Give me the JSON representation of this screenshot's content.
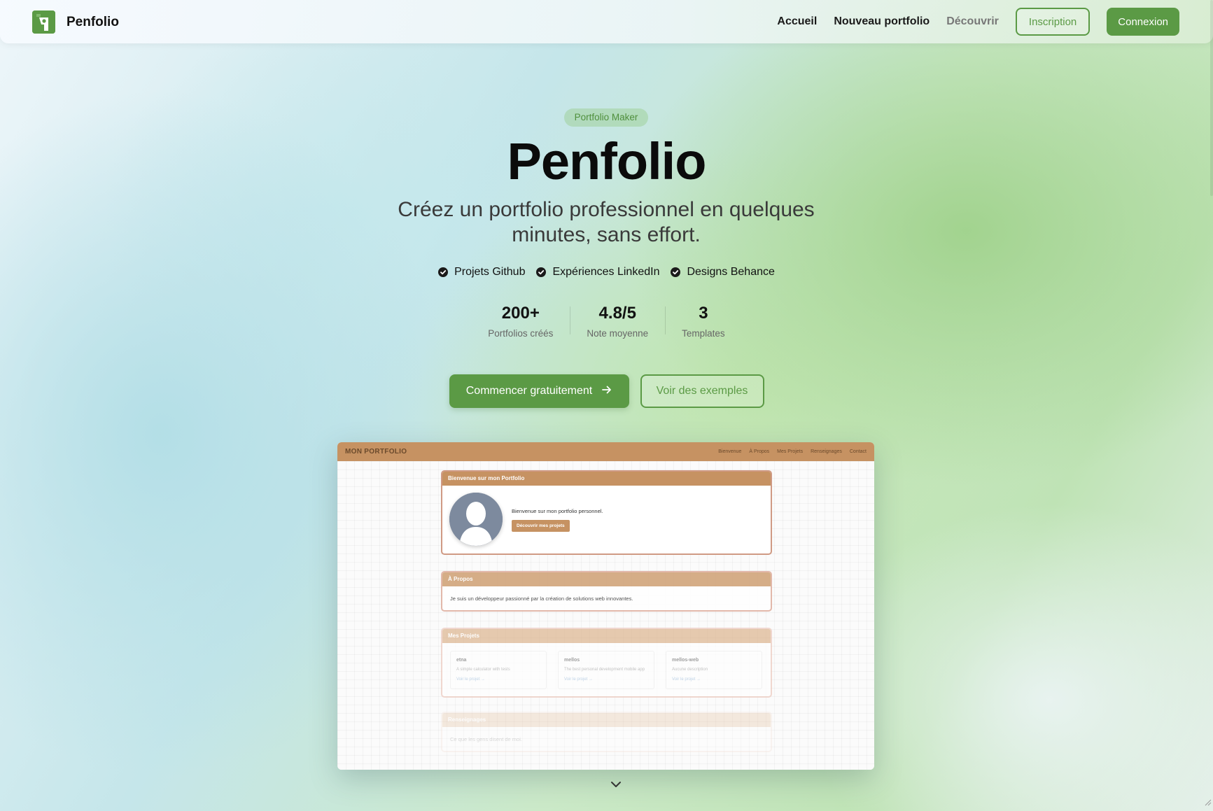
{
  "header": {
    "brand": "Penfolio",
    "nav": {
      "accueil": "Accueil",
      "nouveau": "Nouveau portfolio",
      "decouvrir": "Découvrir",
      "inscription": "Inscription",
      "connexion": "Connexion"
    }
  },
  "hero": {
    "tag": "Portfolio Maker",
    "title": "Penfolio",
    "subtitle": "Créez un portfolio professionnel en quelques minutes, sans effort.",
    "features": [
      "Projets Github",
      "Expériences LinkedIn",
      "Designs Behance"
    ],
    "stats": [
      {
        "value": "200+",
        "label": "Portfolios créés"
      },
      {
        "value": "4.8/5",
        "label": "Note moyenne"
      },
      {
        "value": "3",
        "label": "Templates"
      }
    ],
    "cta_primary": "Commencer gratuitement",
    "cta_secondary": "Voir des exemples"
  },
  "preview": {
    "brand": "MON PORTFOLIO",
    "nav": [
      "Bienvenue",
      "À Propos",
      "Mes Projets",
      "Renseignages",
      "Contact"
    ],
    "welcome": {
      "title": "Bienvenue sur mon Portfolio",
      "text": "Bienvenue sur mon portfolio personnel.",
      "button": "Découvrir mes projets"
    },
    "about": {
      "title": "À Propos",
      "text": "Je suis un développeur passionné par la création de solutions web innovantes."
    },
    "projects": {
      "title": "Mes Projets",
      "items": [
        {
          "name": "etna",
          "desc": "A simple calculator with tests",
          "link": "Voir le projet →"
        },
        {
          "name": "mellos",
          "desc": "The best personal development mobile app",
          "link": "Voir le projet →"
        },
        {
          "name": "mellos-web",
          "desc": "Aucune description",
          "link": "Voir le projet →"
        }
      ]
    },
    "renseignages": {
      "title": "Renseignages",
      "text": "Ce que les gens disent de moi."
    }
  },
  "colors": {
    "accent": "#5b9a45",
    "preview_brown": "#c69262"
  },
  "icons": {
    "logo": "penfolio-logo-icon",
    "check": "check-circle-icon",
    "arrow": "arrow-right-icon",
    "scroll": "chevron-down-icon"
  }
}
